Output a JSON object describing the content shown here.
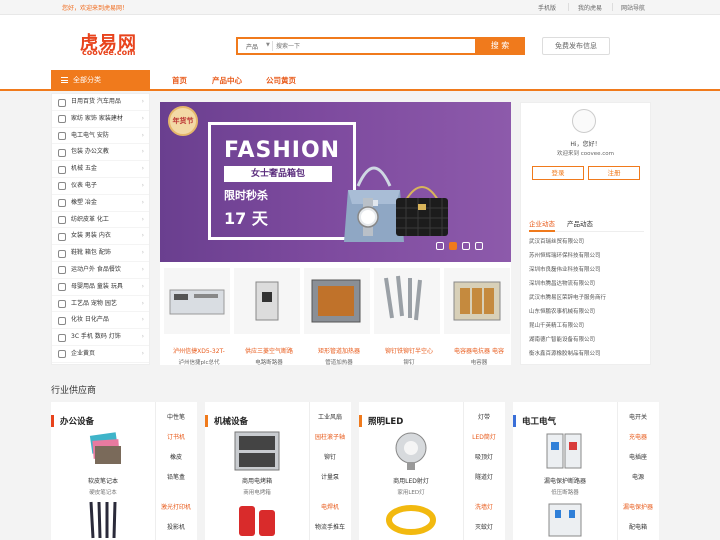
{
  "topbar": {
    "welcome": "您好，欢迎来到虎易网！",
    "links": [
      "手机版",
      "我的虎易",
      "网站导航"
    ]
  },
  "header": {
    "logo_cn": "虎易网",
    "logo_en": "coovee.com",
    "search": {
      "category": "产品",
      "placeholder": "搜索一下",
      "button": "搜 索"
    },
    "post_button": "免费发布信息"
  },
  "nav": {
    "all_categories": "全部分类",
    "links": [
      "首页",
      "产品中心",
      "公司黄页"
    ]
  },
  "categories": [
    "日用百货  汽车用品",
    "家纺  家饰  家装建材",
    "电工电气  安防",
    "包装  办公文教",
    "机械  五金",
    "仪表  电子",
    "橡塑  冶金",
    "纺织皮革  化工",
    "女装  男装  内衣",
    "鞋靴  箱包  配饰",
    "运动户外  食品餐饮",
    "母婴用品  童装  玩具",
    "工艺品  宠物  园艺",
    "化妆  日化产品",
    "3C  手机  数码  灯饰",
    "企业黄页"
  ],
  "banner": {
    "stamp": "年货节",
    "title": "FASHION",
    "subtitle": "女士奢品箱包",
    "promo": "限时秒杀",
    "days": "17 天"
  },
  "products": [
    {
      "name": "泸州信捷XD5-32T-",
      "sub": "泸州信捷plc总代"
    },
    {
      "name": "供应三菱空气断路",
      "sub": "电路断路器"
    },
    {
      "name": "矩形管道加热器",
      "sub": "管道加热器"
    },
    {
      "name": "铆钉铁铆钉半空心",
      "sub": "铆钉"
    },
    {
      "name": "电容器电抗器 电容",
      "sub": "电容器"
    }
  ],
  "user_panel": {
    "greeting": "Hi，您好！",
    "welcome": "欢迎来到 coovee.com",
    "login": "登录",
    "register": "注册",
    "tabs": [
      "企业动态",
      "产品动态"
    ],
    "companies": [
      "武汉百瑞丝贸有限公司",
      "苏州恒辉瑞环保科技有限公司",
      "深圳市良磊伟业科技有限公司",
      "深圳市腾昌达物流有限公司",
      "武汉市腾易区荣辞电子服务商行",
      "山东恒鹏农事机械有限公司",
      "昆山千英精工有限公司",
      "湖南德广智能设备有限公司",
      "衡水鑫百源橡胶制品有限公司"
    ]
  },
  "industry": {
    "title": "行业供应商",
    "blocks": [
      {
        "name": "办公设备",
        "color": "#e8431c",
        "items": [
          {
            "title": "软皮笔记本",
            "sub": "硬皮笔记本"
          },
          {
            "title": "",
            "sub": ""
          }
        ],
        "side": [
          "中性笔",
          "订书机",
          "橡皮",
          "铅笔盒",
          "激光打印机",
          "投影机"
        ]
      },
      {
        "name": "机械设备",
        "color": "#f07a1c",
        "items": [
          {
            "title": "商用电烤箱",
            "sub": "商用电烤箱"
          },
          {
            "title": "",
            "sub": ""
          }
        ],
        "side": [
          "工业风扇",
          "园柱滚子轴",
          "铆钉",
          "计量泵",
          "电焊机",
          "物流手推车"
        ]
      },
      {
        "name": "照明LED",
        "color": "#f07a1c",
        "items": [
          {
            "title": "商用LED射灯",
            "sub": "家用LED灯"
          },
          {
            "title": "",
            "sub": ""
          }
        ],
        "side": [
          "灯带",
          "LED筒灯",
          "吸顶灯",
          "隧道灯",
          "洗墙灯",
          "灭蚊灯"
        ]
      },
      {
        "name": "电工电气",
        "color": "#3a6fd8",
        "items": [
          {
            "title": "漏电保护断路器",
            "sub": "低压断路器"
          },
          {
            "title": "",
            "sub": ""
          }
        ],
        "side": [
          "电开关",
          "充电器",
          "电插座",
          "电源",
          "漏电保护器",
          "配电箱"
        ]
      }
    ]
  }
}
